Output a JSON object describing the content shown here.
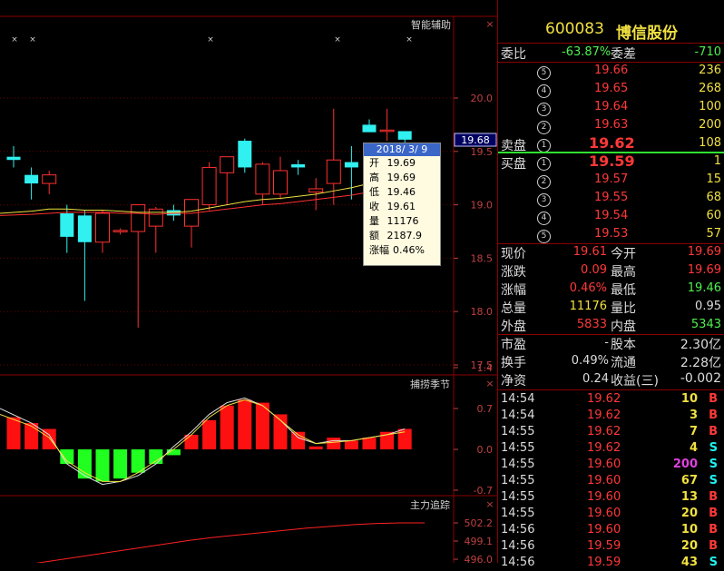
{
  "panels": {
    "main_title": "智能辅助",
    "indicator1_title": "捕捞季节",
    "indicator2_title": "主力追踪"
  },
  "price_axis": [
    "20.0",
    "19.5",
    "19.0",
    "18.5",
    "18.0",
    "17.5"
  ],
  "price_cursor": "19.68",
  "ind1_axis": [
    "1.4",
    "0.7",
    "0.0",
    "-0.7"
  ],
  "ind2_axis": [
    "502.2",
    "499.1",
    "496.0"
  ],
  "markers": [
    "×",
    "×",
    "×",
    "×",
    "×"
  ],
  "close_marks": [
    "×",
    "×",
    "×"
  ],
  "tooltip": {
    "date": "2018/ 3/ 9",
    "rows": [
      {
        "k": "开",
        "v": "19.69"
      },
      {
        "k": "高",
        "v": "19.69"
      },
      {
        "k": "低",
        "v": "19.46"
      },
      {
        "k": "收",
        "v": "19.61"
      },
      {
        "k": "量",
        "v": "11176"
      },
      {
        "k": "额",
        "v": "2187.9"
      },
      {
        "k": "涨幅",
        "v": "0.46%"
      }
    ]
  },
  "chart_data": {
    "type": "candlestick",
    "ylim": [
      17.4,
      20.4
    ],
    "candles": [
      {
        "o": 19.45,
        "h": 19.55,
        "l": 19.35,
        "c": 19.42
      },
      {
        "o": 19.28,
        "h": 19.35,
        "l": 19.05,
        "c": 19.2
      },
      {
        "o": 19.2,
        "h": 19.32,
        "l": 19.1,
        "c": 19.28
      },
      {
        "o": 18.92,
        "h": 19.0,
        "l": 18.55,
        "c": 18.7
      },
      {
        "o": 18.9,
        "h": 18.95,
        "l": 18.1,
        "c": 18.65
      },
      {
        "o": 18.65,
        "h": 18.95,
        "l": 18.55,
        "c": 18.92
      },
      {
        "o": 18.75,
        "h": 18.78,
        "l": 18.72,
        "c": 18.76
      },
      {
        "o": 18.75,
        "h": 19.0,
        "l": 17.85,
        "c": 19.0
      },
      {
        "o": 18.8,
        "h": 18.98,
        "l": 18.55,
        "c": 18.96
      },
      {
        "o": 18.95,
        "h": 19.0,
        "l": 18.85,
        "c": 18.9
      },
      {
        "o": 18.8,
        "h": 19.05,
        "l": 18.6,
        "c": 19.05
      },
      {
        "o": 19.0,
        "h": 19.4,
        "l": 18.95,
        "c": 19.35
      },
      {
        "o": 19.3,
        "h": 19.45,
        "l": 19.0,
        "c": 19.45
      },
      {
        "o": 19.6,
        "h": 19.62,
        "l": 19.3,
        "c": 19.35
      },
      {
        "o": 19.1,
        "h": 19.4,
        "l": 19.0,
        "c": 19.38
      },
      {
        "o": 19.1,
        "h": 19.45,
        "l": 19.05,
        "c": 19.32
      },
      {
        "o": 19.38,
        "h": 19.42,
        "l": 19.28,
        "c": 19.35
      },
      {
        "o": 19.12,
        "h": 19.25,
        "l": 18.95,
        "c": 19.15
      },
      {
        "o": 19.2,
        "h": 19.9,
        "l": 19.0,
        "c": 19.42
      },
      {
        "o": 19.4,
        "h": 19.55,
        "l": 19.05,
        "c": 19.35
      },
      {
        "o": 19.75,
        "h": 19.8,
        "l": 19.68,
        "c": 19.68
      },
      {
        "o": 19.7,
        "h": 19.9,
        "l": 19.6,
        "c": 19.7
      },
      {
        "o": 19.69,
        "h": 19.69,
        "l": 19.46,
        "c": 19.61
      }
    ],
    "ma_yellow": [
      18.92,
      18.94,
      18.96,
      18.96,
      18.95,
      18.95,
      18.94,
      18.93,
      18.93,
      18.93,
      18.94,
      18.97,
      19.0,
      19.03,
      19.05,
      19.06,
      19.08,
      19.1,
      19.13,
      19.16,
      19.2,
      19.25,
      19.28
    ],
    "ma_red": [
      18.9,
      18.91,
      18.92,
      18.93,
      18.93,
      18.93,
      18.92,
      18.92,
      18.91,
      18.92,
      18.92,
      18.94,
      18.96,
      18.98,
      19.0,
      19.01,
      19.03,
      19.05,
      19.07,
      19.09,
      19.12,
      19.16,
      19.2
    ],
    "macd_ylim": [
      -1.2,
      1.9
    ],
    "macd_bars": [
      0.55,
      0.45,
      0.35,
      -0.25,
      -0.5,
      -0.55,
      -0.5,
      -0.4,
      -0.25,
      -0.1,
      0.25,
      0.5,
      0.75,
      0.85,
      0.8,
      0.6,
      0.3,
      0.05,
      0.2,
      0.15,
      0.2,
      0.3,
      0.35
    ],
    "macd_line1": [
      0.7,
      0.45,
      0.25,
      -0.25,
      -0.45,
      -0.6,
      -0.55,
      -0.45,
      -0.25,
      0.05,
      0.3,
      0.6,
      0.8,
      0.88,
      0.75,
      0.5,
      0.2,
      0.1,
      0.15,
      0.15,
      0.2,
      0.25,
      0.35
    ],
    "macd_line2": [
      0.6,
      0.4,
      0.2,
      -0.2,
      -0.4,
      -0.55,
      -0.55,
      -0.4,
      -0.2,
      0.0,
      0.25,
      0.55,
      0.75,
      0.85,
      0.75,
      0.5,
      0.25,
      0.1,
      0.12,
      0.15,
      0.2,
      0.25,
      0.3
    ],
    "trace_ylim": [
      495.2,
      504.0
    ],
    "trace": [
      494.5,
      495.0,
      495.6,
      496.2,
      496.8,
      497.4,
      498.0,
      498.6,
      499.2,
      499.7,
      500.1,
      500.5,
      500.9,
      501.3,
      501.6,
      501.9,
      502.1,
      502.2,
      502.2
    ]
  },
  "quote": {
    "code": "600083",
    "name": "博信股份",
    "ratio_label": "委比",
    "ratio_value": "-63.87%",
    "diff_label": "委差",
    "diff_value": "-710",
    "sell_label": "卖盘",
    "buy_label": "买盘",
    "sells": [
      {
        "n": "5",
        "p": "19.66",
        "v": "236"
      },
      {
        "n": "4",
        "p": "19.65",
        "v": "268"
      },
      {
        "n": "3",
        "p": "19.64",
        "v": "100"
      },
      {
        "n": "2",
        "p": "19.63",
        "v": "200"
      },
      {
        "n": "1",
        "p": "19.62",
        "v": "108"
      }
    ],
    "buys": [
      {
        "n": "1",
        "p": "19.59",
        "v": "1"
      },
      {
        "n": "2",
        "p": "19.57",
        "v": "15"
      },
      {
        "n": "3",
        "p": "19.55",
        "v": "68"
      },
      {
        "n": "4",
        "p": "19.54",
        "v": "60"
      },
      {
        "n": "5",
        "p": "19.53",
        "v": "57"
      }
    ],
    "stats": [
      {
        "l1": "现价",
        "v1": "19.61",
        "c1": "red",
        "l2": "今开",
        "v2": "19.69",
        "c2": "red"
      },
      {
        "l1": "涨跌",
        "v1": "0.09",
        "c1": "red",
        "l2": "最高",
        "v2": "19.69",
        "c2": "red"
      },
      {
        "l1": "涨幅",
        "v1": "0.46%",
        "c1": "red",
        "l2": "最低",
        "v2": "19.46",
        "c2": "green"
      },
      {
        "l1": "总量",
        "v1": "11176",
        "c1": "yellow",
        "l2": "量比",
        "v2": "0.95",
        "c2": "white"
      },
      {
        "l1": "外盘",
        "v1": "5833",
        "c1": "red",
        "l2": "内盘",
        "v2": "5343",
        "c2": "green"
      }
    ],
    "fund": [
      {
        "l1": "市盈",
        "v1": "-",
        "l2": "股本",
        "v2": "2.30亿"
      },
      {
        "l1": "换手",
        "v1": "0.49%",
        "l2": "流通",
        "v2": "2.28亿"
      },
      {
        "l1": "净资",
        "v1": "0.24",
        "l2": "收益(三)",
        "v2": "-0.002"
      }
    ],
    "ticks": [
      {
        "t": "14:54",
        "p": "19.62",
        "v": "10",
        "vc": "yellow",
        "s": "B"
      },
      {
        "t": "14:54",
        "p": "19.62",
        "v": "3",
        "vc": "yellow",
        "s": "B"
      },
      {
        "t": "14:55",
        "p": "19.62",
        "v": "7",
        "vc": "yellow",
        "s": "B"
      },
      {
        "t": "14:55",
        "p": "19.62",
        "v": "4",
        "vc": "yellow",
        "s": "S"
      },
      {
        "t": "14:55",
        "p": "19.60",
        "v": "200",
        "vc": "magenta",
        "s": "S"
      },
      {
        "t": "14:55",
        "p": "19.60",
        "v": "67",
        "vc": "yellow",
        "s": "S"
      },
      {
        "t": "14:55",
        "p": "19.60",
        "v": "13",
        "vc": "yellow",
        "s": "B"
      },
      {
        "t": "14:55",
        "p": "19.60",
        "v": "20",
        "vc": "yellow",
        "s": "B"
      },
      {
        "t": "14:56",
        "p": "19.60",
        "v": "10",
        "vc": "yellow",
        "s": "B"
      },
      {
        "t": "14:56",
        "p": "19.59",
        "v": "20",
        "vc": "yellow",
        "s": "B"
      },
      {
        "t": "14:56",
        "p": "19.59",
        "v": "43",
        "vc": "yellow",
        "s": "S"
      }
    ]
  }
}
